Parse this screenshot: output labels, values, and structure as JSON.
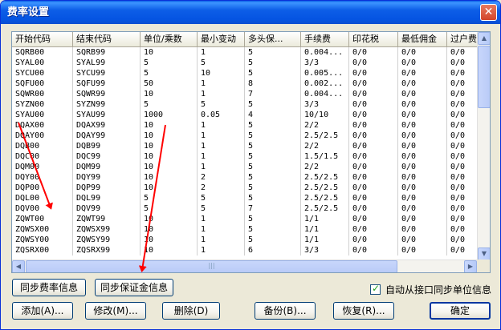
{
  "window": {
    "title": "费率设置",
    "close_glyph": "✕"
  },
  "table": {
    "columns": [
      "开始代码",
      "结束代码",
      "单位/乘数",
      "最小变动",
      "多头保...",
      "手续费",
      "印花税",
      "最低佣金",
      "过户费"
    ],
    "rows": [
      [
        "SQRB00",
        "SQRB99",
        "10",
        "1",
        "5",
        "0.004...",
        "0/0",
        "0/0",
        "0/0"
      ],
      [
        "SYAL00",
        "SYAL99",
        "5",
        "5",
        "5",
        "3/3",
        "0/0",
        "0/0",
        "0/0"
      ],
      [
        "SYCU00",
        "SYCU99",
        "5",
        "10",
        "5",
        "0.005...",
        "0/0",
        "0/0",
        "0/0"
      ],
      [
        "SQFU00",
        "SQFU99",
        "50",
        "1",
        "8",
        "0.002...",
        "0/0",
        "0/0",
        "0/0"
      ],
      [
        "SQWR00",
        "SQWR99",
        "10",
        "1",
        "7",
        "0.004...",
        "0/0",
        "0/0",
        "0/0"
      ],
      [
        "SYZN00",
        "SYZN99",
        "5",
        "5",
        "5",
        "3/3",
        "0/0",
        "0/0",
        "0/0"
      ],
      [
        "SYAU00",
        "SYAU99",
        "1000",
        "0.05",
        "4",
        "10/10",
        "0/0",
        "0/0",
        "0/0"
      ],
      [
        "DQAX00",
        "DQAX99",
        "10",
        "1",
        "5",
        "2/2",
        "0/0",
        "0/0",
        "0/0"
      ],
      [
        "DQAY00",
        "DQAY99",
        "10",
        "1",
        "5",
        "2.5/2.5",
        "0/0",
        "0/0",
        "0/0"
      ],
      [
        "DQB00",
        "DQB99",
        "10",
        "1",
        "5",
        "2/2",
        "0/0",
        "0/0",
        "0/0"
      ],
      [
        "DQC00",
        "DQC99",
        "10",
        "1",
        "5",
        "1.5/1.5",
        "0/0",
        "0/0",
        "0/0"
      ],
      [
        "DQM00",
        "DQM99",
        "10",
        "1",
        "5",
        "2/2",
        "0/0",
        "0/0",
        "0/0"
      ],
      [
        "DQY00",
        "DQY99",
        "10",
        "2",
        "5",
        "2.5/2.5",
        "0/0",
        "0/0",
        "0/0"
      ],
      [
        "DQP00",
        "DQP99",
        "10",
        "2",
        "5",
        "2.5/2.5",
        "0/0",
        "0/0",
        "0/0"
      ],
      [
        "DQL00",
        "DQL99",
        "5",
        "5",
        "5",
        "2.5/2.5",
        "0/0",
        "0/0",
        "0/0"
      ],
      [
        "DQV00",
        "DQV99",
        "5",
        "5",
        "7",
        "2.5/2.5",
        "0/0",
        "0/0",
        "0/0"
      ],
      [
        "ZQWT00",
        "ZQWT99",
        "10",
        "1",
        "5",
        "1/1",
        "0/0",
        "0/0",
        "0/0"
      ],
      [
        "ZQWSX00",
        "ZQWSX99",
        "10",
        "1",
        "5",
        "1/1",
        "0/0",
        "0/0",
        "0/0"
      ],
      [
        "ZQWSY00",
        "ZQWSY99",
        "10",
        "1",
        "5",
        "1/1",
        "0/0",
        "0/0",
        "0/0"
      ],
      [
        "ZQSRX00",
        "ZQSRX99",
        "10",
        "1",
        "6",
        "3/3",
        "0/0",
        "0/0",
        "0/0"
      ]
    ]
  },
  "scrollbar": {
    "up": "▲",
    "down": "▼",
    "left": "◀",
    "right": "▶",
    "grip": "|||"
  },
  "buttons": {
    "sync_rate": "同步费率信息",
    "sync_margin": "同步保证金信息",
    "add": "添加(A)...",
    "modify": "修改(M)...",
    "delete": "删除(D)",
    "backup": "备份(B)...",
    "restore": "恢复(R)...",
    "ok": "确定"
  },
  "checkbox": {
    "label": "自动从接口同步单位信息",
    "checked": true
  },
  "colors": {
    "title_bar": "#0554e2",
    "arrow": "#ff0000",
    "dialog_bg": "#ece9d8"
  }
}
